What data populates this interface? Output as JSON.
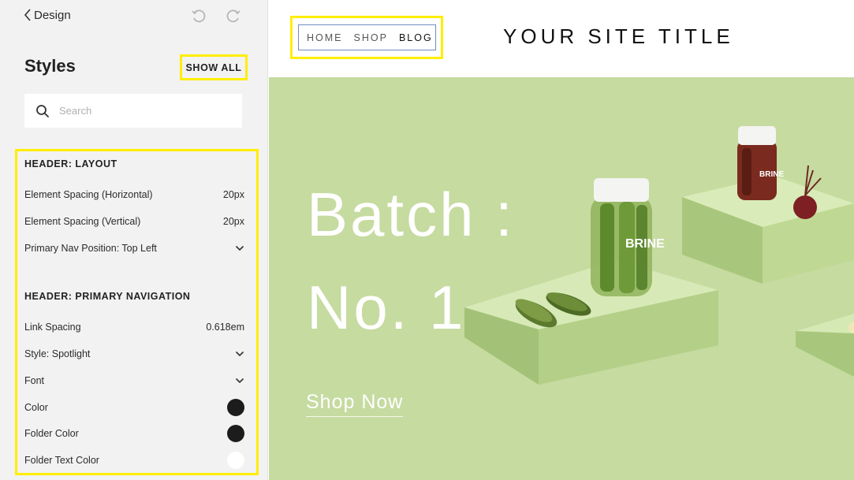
{
  "sidebar": {
    "back_label": "Design",
    "title": "Styles",
    "show_all_label": "SHOW ALL",
    "search_placeholder": "Search",
    "sections": {
      "layout_header": "HEADER: LAYOUT",
      "layout": [
        {
          "label": "Element Spacing (Horizontal)",
          "value": "20px"
        },
        {
          "label": "Element Spacing (Vertical)",
          "value": "20px"
        },
        {
          "label": "Primary Nav Position: Top Left"
        }
      ],
      "nav_header": "HEADER: PRIMARY NAVIGATION",
      "nav": [
        {
          "label": "Link Spacing",
          "value": "0.618em"
        },
        {
          "label": "Style: Spotlight"
        },
        {
          "label": "Font"
        },
        {
          "label": "Color",
          "color": "#1c1c1c"
        },
        {
          "label": "Folder Color",
          "color": "#1c1c1c"
        },
        {
          "label": "Folder Text Color",
          "color": "#ffffff"
        }
      ]
    }
  },
  "site": {
    "nav": [
      "HOME",
      "SHOP",
      "BLOG"
    ],
    "title": "YOUR SITE TITLE",
    "hero": {
      "title_line1": "Batch :",
      "title_line2": "No. 1",
      "cta": "Shop Now",
      "jar_label": "BRINE"
    }
  },
  "colors": {
    "highlight": "#ffee00",
    "hero_bg": "#c6dba0",
    "sidebar_bg": "#f2f2f2"
  }
}
